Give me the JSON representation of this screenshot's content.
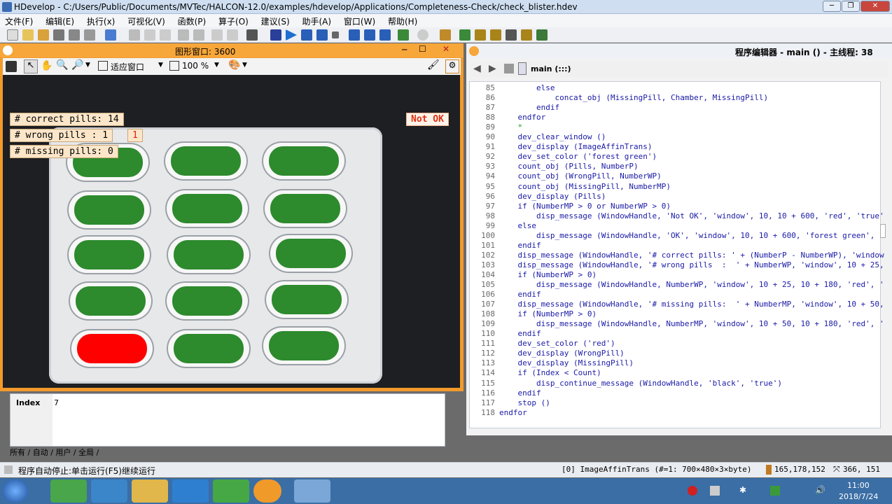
{
  "window": {
    "title": "HDevelop - C:/Users/Public/Documents/MVTec/HALCON-12.0/examples/hdevelop/Applications/Completeness-Check/check_blister.hdev"
  },
  "menu": [
    "文件(F)",
    "编辑(E)",
    "执行(x)",
    "可视化(V)",
    "函数(P)",
    "算子(O)",
    "建议(S)",
    "助手(A)",
    "窗口(W)",
    "帮助(H)"
  ],
  "graphics": {
    "title": "图形窗口: 3600",
    "zoom_mode": "适应窗口",
    "zoom_percent": "100 %",
    "labels": {
      "correct": "# correct pills: 14",
      "wrong": "# wrong pills  :  1",
      "wrong_count": "1",
      "missing": "# missing pills:  0",
      "status": "Not OK"
    }
  },
  "variables": {
    "name": "Index",
    "value": "7"
  },
  "tabs_text": "所有 / 自动 / 用户 / 全局 /",
  "editor": {
    "title": "程序编辑器 - main () - 主线程: 38",
    "procedure": "main (:::)",
    "lines": [
      {
        "n": "85",
        "t": "        else"
      },
      {
        "n": "86",
        "t": "            concat_obj (MissingPill, Chamber, MissingPill)"
      },
      {
        "n": "87",
        "t": "        endif"
      },
      {
        "n": "88",
        "t": "    endfor"
      },
      {
        "n": "89",
        "t": "    *"
      },
      {
        "n": "90",
        "t": "    dev_clear_window ()"
      },
      {
        "n": "91",
        "t": "    dev_display (ImageAffinTrans)"
      },
      {
        "n": "92",
        "t": "    dev_set_color ('forest green')"
      },
      {
        "n": "93",
        "t": "    count_obj (Pills, NumberP)"
      },
      {
        "n": "94",
        "t": "    count_obj (WrongPill, NumberWP)"
      },
      {
        "n": "95",
        "t": "    count_obj (MissingPill, NumberMP)"
      },
      {
        "n": "96",
        "t": "    dev_display (Pills)"
      },
      {
        "n": "97",
        "t": "    if (NumberMP > 0 or NumberWP > 0)"
      },
      {
        "n": "98",
        "t": "        disp_message (WindowHandle, 'Not OK', 'window', 10, 10 + 600, 'red', 'true'"
      },
      {
        "n": "99",
        "t": "    else"
      },
      {
        "n": "100",
        "t": "        disp_message (WindowHandle, 'OK', 'window', 10, 10 + 600, 'forest green', '"
      },
      {
        "n": "101",
        "t": "    endif"
      },
      {
        "n": "102",
        "t": "    disp_message (WindowHandle, '# correct pills: ' + (NumberP - NumberWP), 'window"
      },
      {
        "n": "103",
        "t": "    disp_message (WindowHandle, '# wrong pills  :  ' + NumberWP, 'window', 10 + 25,"
      },
      {
        "n": "104",
        "t": "    if (NumberWP > 0)"
      },
      {
        "n": "105",
        "t": "        disp_message (WindowHandle, NumberWP, 'window', 10 + 25, 10 + 180, 'red', '"
      },
      {
        "n": "106",
        "t": "    endif"
      },
      {
        "n": "107",
        "t": "    disp_message (WindowHandle, '# missing pills:  ' + NumberMP, 'window', 10 + 50,"
      },
      {
        "n": "108",
        "t": "    if (NumberMP > 0)"
      },
      {
        "n": "109",
        "t": "        disp_message (WindowHandle, NumberMP, 'window', 10 + 50, 10 + 180, 'red', '"
      },
      {
        "n": "110",
        "t": "    endif"
      },
      {
        "n": "111",
        "t": "    dev_set_color ('red')"
      },
      {
        "n": "112",
        "t": "    dev_display (WrongPill)"
      },
      {
        "n": "113",
        "t": "    dev_display (MissingPill)"
      },
      {
        "n": "114",
        "t": "    if (Index < Count)"
      },
      {
        "n": "115",
        "t": "        disp_continue_message (WindowHandle, 'black', 'true')"
      },
      {
        "n": "116",
        "t": "    endif"
      },
      {
        "n": "117",
        "t": "    stop ()"
      },
      {
        "n": "118",
        "t": "endfor"
      }
    ]
  },
  "status": {
    "message": "程序自动停止:单击运行(F5)继续运行",
    "image_info": "[0] ImageAffinTrans (#=1: 700×480×3×byte)",
    "pixel": "165,178,152",
    "coords": "366, 151"
  },
  "taskbar": {
    "time": "11:00",
    "date": "2018/7/24"
  },
  "colors": {
    "accent": "#f7a63a",
    "pill_ok": "#2d8a2d",
    "pill_wrong": "#ff0000"
  }
}
